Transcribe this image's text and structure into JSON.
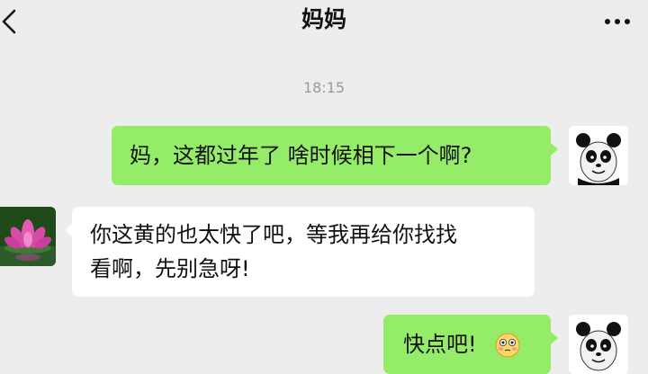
{
  "header": {
    "title": "妈妈",
    "back_icon": "chevron-left-icon",
    "more_icon": "ellipsis-icon"
  },
  "chat": {
    "timestamp": "18:15",
    "messages": [
      {
        "sender": "me",
        "text": "妈，这都过年了 啥时候相下一个啊?"
      },
      {
        "sender": "mom",
        "text_line1": "你这黄的也太快了吧，等我再给你找找",
        "text_line2": "看啊，先别急呀!"
      },
      {
        "sender": "me",
        "text": "快点吧!",
        "emoji": "flushed-face-icon"
      }
    ]
  },
  "colors": {
    "background": "#ededed",
    "outgoing_bubble": "#95ec69",
    "incoming_bubble": "#ffffff",
    "timestamp": "#9a9a9a"
  }
}
